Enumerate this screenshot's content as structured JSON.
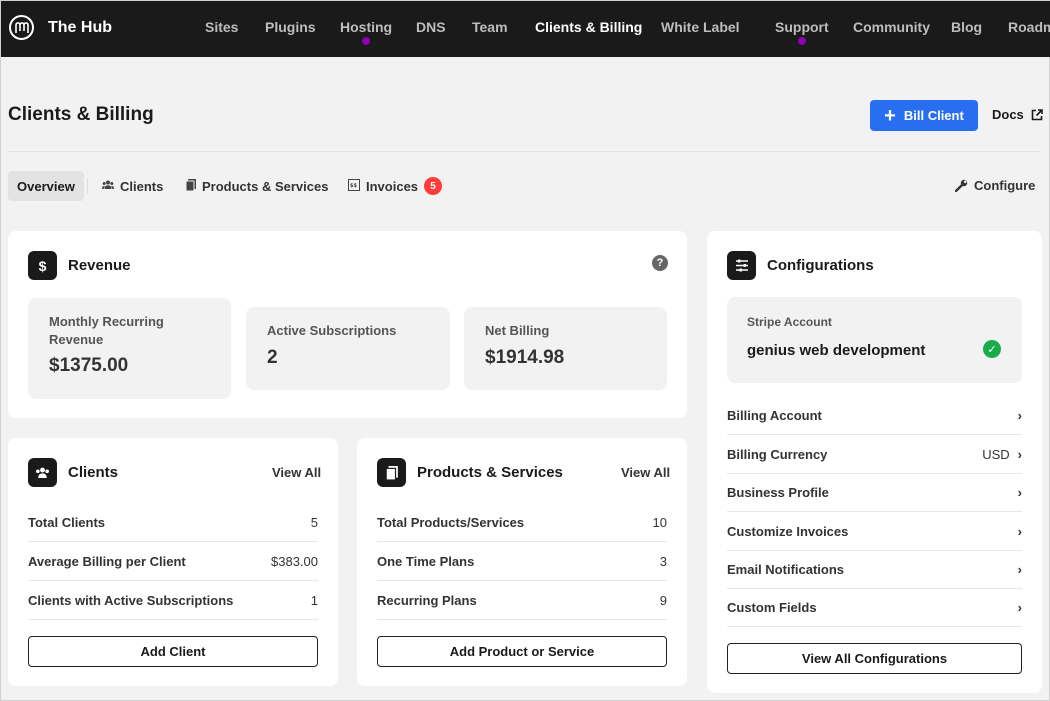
{
  "nav": {
    "brand": "The Hub",
    "items": [
      "Sites",
      "Plugins",
      "Hosting",
      "DNS",
      "Team",
      "Clients & Billing",
      "White Label",
      "Support",
      "Community",
      "Blog",
      "Roadmap"
    ]
  },
  "header": {
    "title": "Clients & Billing",
    "bill_client": "Bill Client",
    "docs": "Docs"
  },
  "tabs": {
    "overview": "Overview",
    "clients": "Clients",
    "products": "Products & Services",
    "invoices": "Invoices",
    "invoices_badge": "5",
    "configure": "Configure"
  },
  "revenue": {
    "title": "Revenue",
    "help": "?",
    "mrr_label": "Monthly Recurring Revenue",
    "mrr_value": "$1375.00",
    "subs_label": "Active Subscriptions",
    "subs_value": "2",
    "net_label": "Net Billing",
    "net_value": "$1914.98"
  },
  "clients": {
    "title": "Clients",
    "view_all": "View All",
    "rows": [
      {
        "label": "Total Clients",
        "value": "5"
      },
      {
        "label": "Average Billing per Client",
        "value": "$383.00"
      },
      {
        "label": "Clients with Active Subscriptions",
        "value": "1"
      }
    ],
    "button": "Add Client"
  },
  "products": {
    "title": "Products & Services",
    "view_all": "View All",
    "rows": [
      {
        "label": "Total Products/Services",
        "value": "10"
      },
      {
        "label": "One Time Plans",
        "value": "3"
      },
      {
        "label": "Recurring Plans",
        "value": "9"
      }
    ],
    "button": "Add Product or Service"
  },
  "configurations": {
    "title": "Configurations",
    "stripe_label": "Stripe Account",
    "stripe_value": "genius web development",
    "items": [
      {
        "label": "Billing Account",
        "value": ""
      },
      {
        "label": "Billing Currency",
        "value": "USD"
      },
      {
        "label": "Business Profile",
        "value": ""
      },
      {
        "label": "Customize Invoices",
        "value": ""
      },
      {
        "label": "Email Notifications",
        "value": ""
      },
      {
        "label": "Custom Fields",
        "value": ""
      }
    ],
    "button": "View All Configurations"
  },
  "colors": {
    "nav_bg": "#1a1a1a",
    "primary": "#286ef1",
    "badge": "#ff3b3b",
    "success": "#1aab4b",
    "nav_dot": "#8d00b1"
  }
}
